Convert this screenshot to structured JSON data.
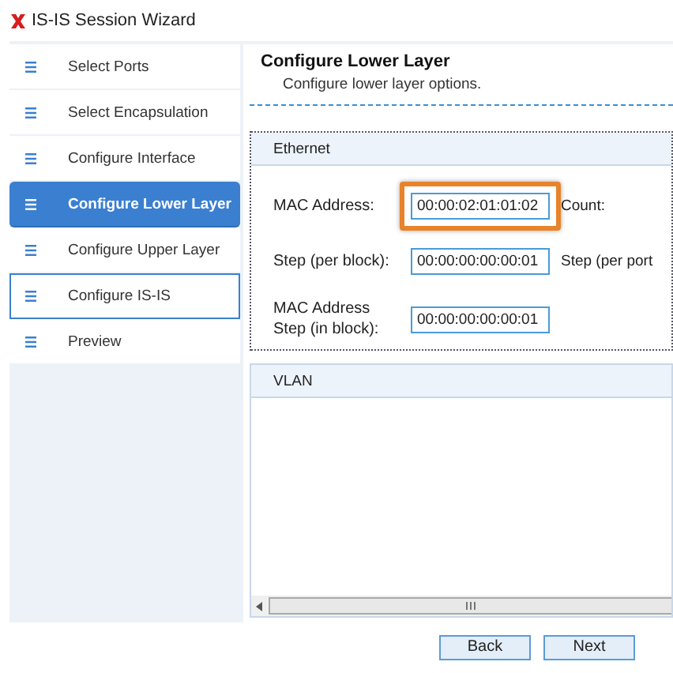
{
  "window": {
    "title": "IS-IS Session Wizard"
  },
  "steps": [
    {
      "label": "Select Ports",
      "selected": false,
      "focused": false
    },
    {
      "label": "Select Encapsulation",
      "selected": false,
      "focused": false
    },
    {
      "label": "Configure Interface",
      "selected": false,
      "focused": false
    },
    {
      "label": "Configure Lower Layer",
      "selected": true,
      "focused": false
    },
    {
      "label": "Configure Upper Layer",
      "selected": false,
      "focused": false
    },
    {
      "label": "Configure IS-IS",
      "selected": false,
      "focused": true
    },
    {
      "label": "Preview",
      "selected": false,
      "focused": false
    }
  ],
  "page": {
    "title": "Configure Lower Layer",
    "subtitle": "Configure lower layer options."
  },
  "ethernet": {
    "title": "Ethernet",
    "fields": [
      {
        "label": "MAC Address:",
        "value": "00:00:02:01:01:02",
        "highlighted": true,
        "side_label": "Count:"
      },
      {
        "label": "Step (per block):",
        "value": "00:00:00:00:00:01",
        "highlighted": false,
        "side_label": "Step (per port"
      },
      {
        "label": "MAC Address Step (in block):",
        "value": "00:00:00:00:00:01",
        "highlighted": false
      }
    ]
  },
  "vlan": {
    "title": "VLAN"
  },
  "buttons": [
    "Back",
    "Next"
  ]
}
